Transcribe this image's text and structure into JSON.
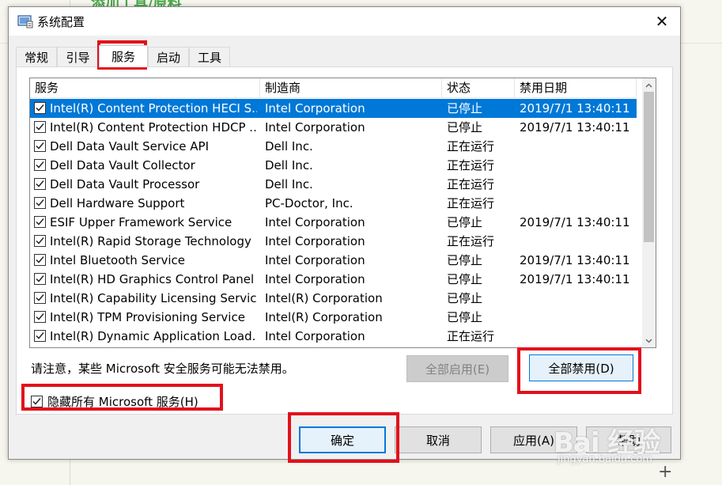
{
  "background": {
    "top_text": "添加工具/原料",
    "watermark": "Bai 经验",
    "watermark_sub": "jingyan.baidu.com",
    "plus": "+"
  },
  "dialog": {
    "title": "系统配置",
    "close_glyph": "✕",
    "tabs": [
      {
        "label": "常规"
      },
      {
        "label": "引导"
      },
      {
        "label": "服务",
        "active": true
      },
      {
        "label": "启动"
      },
      {
        "label": "工具"
      }
    ],
    "columns": {
      "service": "服务",
      "manufacturer": "制造商",
      "status": "状态",
      "disabled_date": "禁用日期"
    },
    "services": [
      {
        "name": "Intel(R) Content Protection HECI S...",
        "manufacturer": "Intel Corporation",
        "status": "已停止",
        "date": "2019/7/1 13:40:11",
        "checked": true,
        "selected": true
      },
      {
        "name": "Intel(R) Content Protection HDCP ...",
        "manufacturer": "Intel Corporation",
        "status": "已停止",
        "date": "2019/7/1 13:40:11",
        "checked": true
      },
      {
        "name": "Dell Data Vault Service API",
        "manufacturer": "Dell Inc.",
        "status": "正在运行",
        "date": "",
        "checked": true
      },
      {
        "name": "Dell Data Vault Collector",
        "manufacturer": "Dell Inc.",
        "status": "正在运行",
        "date": "",
        "checked": true
      },
      {
        "name": "Dell Data Vault Processor",
        "manufacturer": "Dell Inc.",
        "status": "正在运行",
        "date": "",
        "checked": true
      },
      {
        "name": "Dell Hardware Support",
        "manufacturer": "PC-Doctor, Inc.",
        "status": "正在运行",
        "date": "",
        "checked": true
      },
      {
        "name": "ESIF Upper Framework Service",
        "manufacturer": "Intel Corporation",
        "status": "已停止",
        "date": "2019/7/1 13:40:11",
        "checked": true
      },
      {
        "name": "Intel(R) Rapid Storage Technology",
        "manufacturer": "Intel Corporation",
        "status": "正在运行",
        "date": "",
        "checked": true
      },
      {
        "name": "Intel Bluetooth Service",
        "manufacturer": "Intel Corporation",
        "status": "已停止",
        "date": "2019/7/1 13:40:11",
        "checked": true
      },
      {
        "name": "Intel(R) HD Graphics Control Panel ...",
        "manufacturer": "Intel Corporation",
        "status": "已停止",
        "date": "2019/7/1 13:40:11",
        "checked": true
      },
      {
        "name": "Intel(R) Capability Licensing Servic...",
        "manufacturer": "Intel(R) Corporation",
        "status": "已停止",
        "date": "",
        "checked": true
      },
      {
        "name": "Intel(R) TPM Provisioning Service",
        "manufacturer": "Intel(R) Corporation",
        "status": "已停止",
        "date": "",
        "checked": true
      },
      {
        "name": "Intel(R) Dynamic Application Load...",
        "manufacturer": "Intel Corporation",
        "status": "正在运行",
        "date": "",
        "checked": true
      }
    ],
    "note": "请注意，某些 Microsoft 安全服务可能无法禁用。",
    "enable_all": "全部启用(E)",
    "disable_all": "全部禁用(D)",
    "hide_ms_label": "隐藏所有 Microsoft 服务(H)",
    "hide_ms_checked": true,
    "ok": "确定",
    "cancel": "取消",
    "apply": "应用(A)",
    "help": "帮助"
  },
  "colors": {
    "selection": "#0078d7",
    "highlight_box": "#e3101c"
  }
}
